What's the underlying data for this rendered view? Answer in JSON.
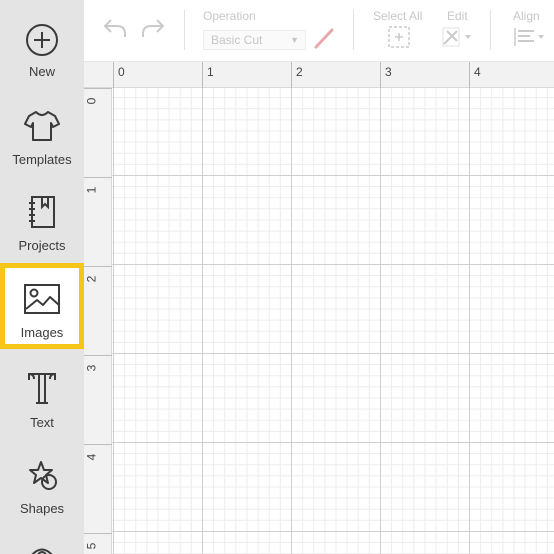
{
  "sidebar": {
    "items": [
      {
        "label": "New",
        "icon": "plus-circle-icon"
      },
      {
        "label": "Templates",
        "icon": "tshirt-icon"
      },
      {
        "label": "Projects",
        "icon": "notebook-icon"
      },
      {
        "label": "Images",
        "icon": "image-icon",
        "active": true
      },
      {
        "label": "Text",
        "icon": "text-t-icon"
      },
      {
        "label": "Shapes",
        "icon": "shapes-icon"
      }
    ],
    "highlight_color": "#f5c518"
  },
  "toolbar": {
    "undo_icon": "undo-icon",
    "redo_icon": "redo-icon",
    "operation_label": "Operation",
    "operation_value": "Basic Cut",
    "select_all_label": "Select All",
    "edit_label": "Edit",
    "align_label": "Align"
  },
  "ruler": {
    "top_ticks": [
      "0",
      "1",
      "2",
      "3",
      "4"
    ],
    "left_ticks": [
      "0",
      "1",
      "2",
      "3",
      "4",
      "5"
    ]
  }
}
